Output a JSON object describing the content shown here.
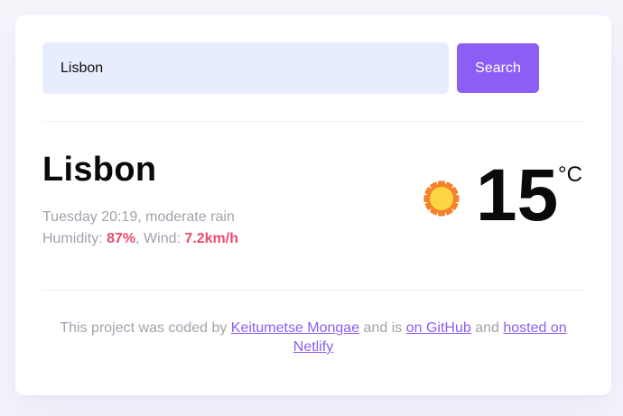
{
  "search": {
    "value": "Lisbon",
    "button_label": "Search"
  },
  "weather": {
    "city": "Lisbon",
    "datetime_description": "Tuesday 20:19, moderate rain",
    "humidity_label": "Humidity: ",
    "humidity_value": "87%",
    "separator": ", ",
    "wind_label": "Wind: ",
    "wind_value": "7.2km/h",
    "temperature": "15",
    "unit": "°C",
    "icon": "sun-icon"
  },
  "footer": {
    "text_1": "This project was coded by ",
    "author_link": "Keitumetse Mongae",
    "text_2": " and is ",
    "github_link": "on GitHub",
    "text_3": " and ",
    "netlify_link": "hosted on Netlify"
  },
  "colors": {
    "accent": "#8c5ef3",
    "highlight": "#ec4a6e",
    "input_bg": "#e8edfd",
    "muted_text": "#a3a1ad"
  }
}
